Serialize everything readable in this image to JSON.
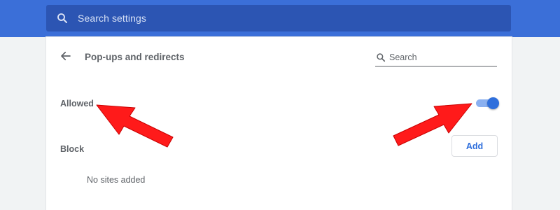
{
  "topbar": {
    "search_placeholder": "Search settings",
    "search_icon": "search-icon"
  },
  "page": {
    "title": "Pop-ups and redirects",
    "back_icon": "back-arrow-icon",
    "search_placeholder": "Search"
  },
  "allowed": {
    "label": "Allowed",
    "toggle_on": true
  },
  "block": {
    "label": "Block",
    "add_label": "Add",
    "empty_text": "No sites added"
  },
  "colors": {
    "topbar": "#3b6fd8",
    "searchbar": "#2c55b3",
    "accent": "#2f6fdc",
    "annotation": "#ff1a1a"
  }
}
